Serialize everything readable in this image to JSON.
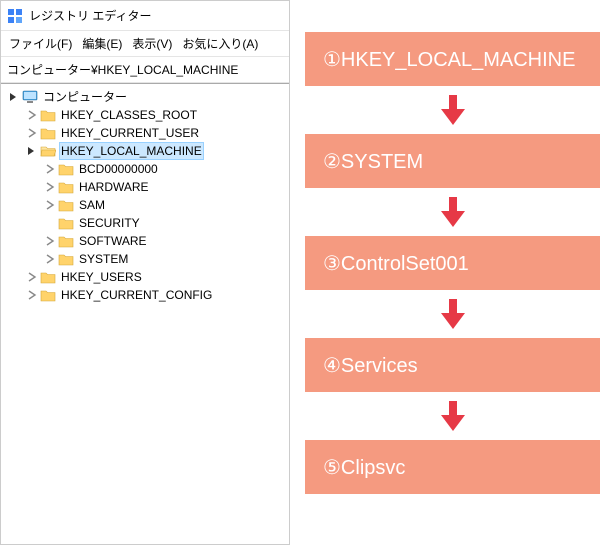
{
  "window": {
    "title": "レジストリ エディター"
  },
  "menu": {
    "file": "ファイル(F)",
    "edit": "編集(E)",
    "view": "表示(V)",
    "favorites": "お気に入り(A)"
  },
  "addressbar": {
    "path": "コンピューター¥HKEY_LOCAL_MACHINE"
  },
  "tree": {
    "root": "コンピューター",
    "hklm_children": {
      "bcd": "BCD00000000",
      "hardware": "HARDWARE",
      "sam": "SAM",
      "security": "SECURITY",
      "software": "SOFTWARE",
      "system": "SYSTEM"
    },
    "keys": {
      "hkcr": "HKEY_CLASSES_ROOT",
      "hkcu": "HKEY_CURRENT_USER",
      "hklm": "HKEY_LOCAL_MACHINE",
      "hku": "HKEY_USERS",
      "hkcc": "HKEY_CURRENT_CONFIG"
    }
  },
  "flow": {
    "s1": "①HKEY_LOCAL_MACHINE",
    "s2": "②SYSTEM",
    "s3": "③ControlSet001",
    "s4": "④Services",
    "s5": "⑤Clipsvc"
  },
  "colors": {
    "accent": "#f59a80",
    "arrow": "#e63946"
  }
}
